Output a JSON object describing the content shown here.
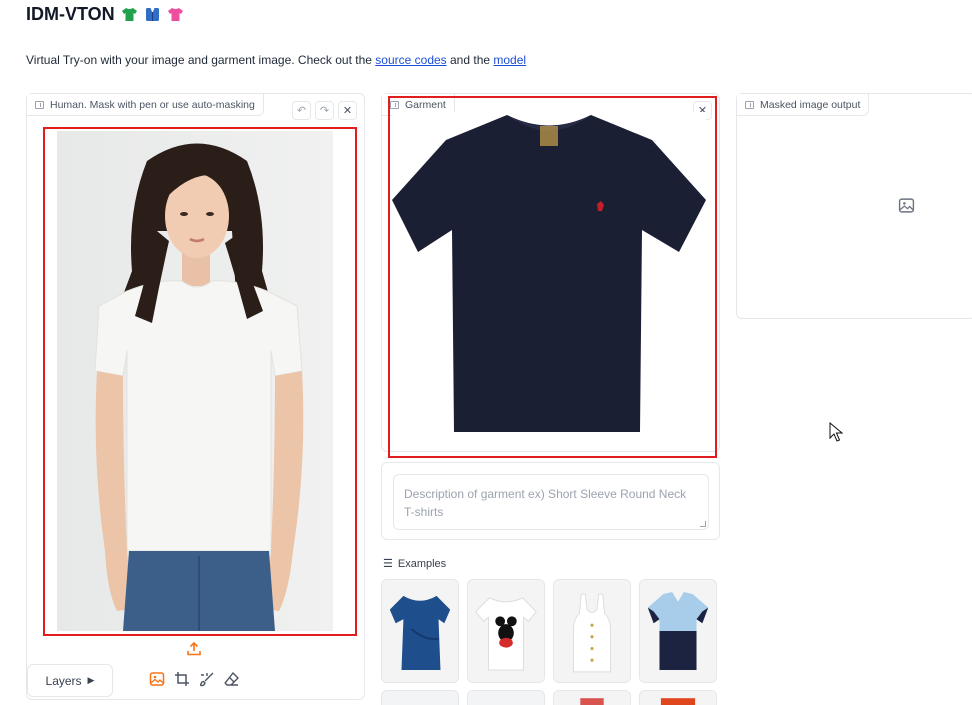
{
  "header": {
    "title": "IDM-VTON",
    "emoji_icons": [
      "green-tshirt-icon",
      "blue-shirt-icon",
      "pink-tshirt-icon"
    ]
  },
  "intro": {
    "text_before": "Virtual Try-on with your image and garment image. Check out the ",
    "link_source": "source codes",
    "text_middle": " and the ",
    "link_model": "model"
  },
  "human_panel": {
    "label": "Human. Mask with pen or use auto-masking",
    "tool_icons": [
      "undo-icon",
      "redo-icon",
      "close-icon"
    ],
    "layers_label": "Layers",
    "bottom_tools": [
      "image-icon",
      "crop-icon",
      "brush-icon",
      "eraser-icon"
    ]
  },
  "garment_panel": {
    "label": "Garment"
  },
  "output_panel": {
    "label": "Masked image output"
  },
  "description": {
    "placeholder": "Description of garment ex) Short Sleeve Round Neck T-shirts"
  },
  "examples": {
    "label": "Examples"
  },
  "colors": {
    "highlight_red": "#e11d1d",
    "link_blue": "#1d4ed8",
    "accent_orange": "#f97316",
    "garment_navy": "#1b1f33"
  }
}
